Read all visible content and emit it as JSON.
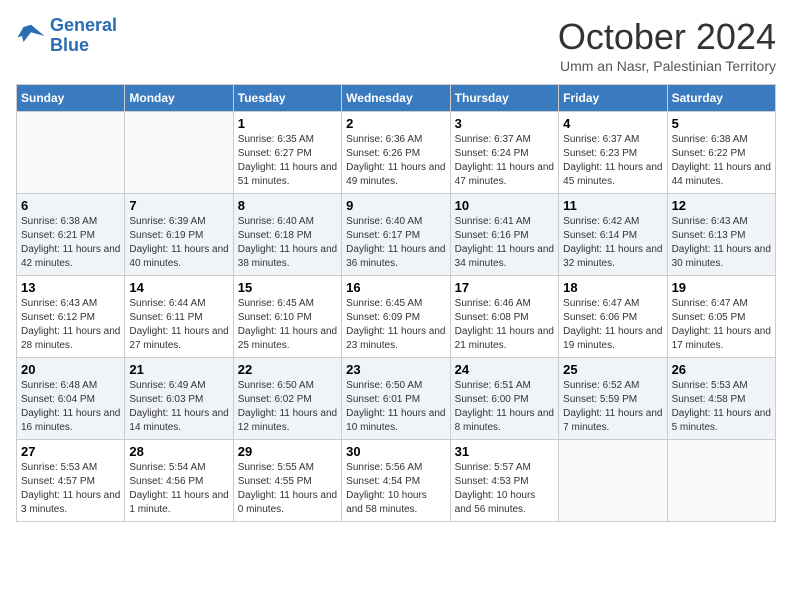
{
  "header": {
    "logo_line1": "General",
    "logo_line2": "Blue",
    "month_year": "October 2024",
    "location": "Umm an Nasr, Palestinian Territory"
  },
  "days_of_week": [
    "Sunday",
    "Monday",
    "Tuesday",
    "Wednesday",
    "Thursday",
    "Friday",
    "Saturday"
  ],
  "weeks": [
    [
      {
        "day": "",
        "info": ""
      },
      {
        "day": "",
        "info": ""
      },
      {
        "day": "1",
        "info": "Sunrise: 6:35 AM\nSunset: 6:27 PM\nDaylight: 11 hours and 51 minutes."
      },
      {
        "day": "2",
        "info": "Sunrise: 6:36 AM\nSunset: 6:26 PM\nDaylight: 11 hours and 49 minutes."
      },
      {
        "day": "3",
        "info": "Sunrise: 6:37 AM\nSunset: 6:24 PM\nDaylight: 11 hours and 47 minutes."
      },
      {
        "day": "4",
        "info": "Sunrise: 6:37 AM\nSunset: 6:23 PM\nDaylight: 11 hours and 45 minutes."
      },
      {
        "day": "5",
        "info": "Sunrise: 6:38 AM\nSunset: 6:22 PM\nDaylight: 11 hours and 44 minutes."
      }
    ],
    [
      {
        "day": "6",
        "info": "Sunrise: 6:38 AM\nSunset: 6:21 PM\nDaylight: 11 hours and 42 minutes."
      },
      {
        "day": "7",
        "info": "Sunrise: 6:39 AM\nSunset: 6:19 PM\nDaylight: 11 hours and 40 minutes."
      },
      {
        "day": "8",
        "info": "Sunrise: 6:40 AM\nSunset: 6:18 PM\nDaylight: 11 hours and 38 minutes."
      },
      {
        "day": "9",
        "info": "Sunrise: 6:40 AM\nSunset: 6:17 PM\nDaylight: 11 hours and 36 minutes."
      },
      {
        "day": "10",
        "info": "Sunrise: 6:41 AM\nSunset: 6:16 PM\nDaylight: 11 hours and 34 minutes."
      },
      {
        "day": "11",
        "info": "Sunrise: 6:42 AM\nSunset: 6:14 PM\nDaylight: 11 hours and 32 minutes."
      },
      {
        "day": "12",
        "info": "Sunrise: 6:43 AM\nSunset: 6:13 PM\nDaylight: 11 hours and 30 minutes."
      }
    ],
    [
      {
        "day": "13",
        "info": "Sunrise: 6:43 AM\nSunset: 6:12 PM\nDaylight: 11 hours and 28 minutes."
      },
      {
        "day": "14",
        "info": "Sunrise: 6:44 AM\nSunset: 6:11 PM\nDaylight: 11 hours and 27 minutes."
      },
      {
        "day": "15",
        "info": "Sunrise: 6:45 AM\nSunset: 6:10 PM\nDaylight: 11 hours and 25 minutes."
      },
      {
        "day": "16",
        "info": "Sunrise: 6:45 AM\nSunset: 6:09 PM\nDaylight: 11 hours and 23 minutes."
      },
      {
        "day": "17",
        "info": "Sunrise: 6:46 AM\nSunset: 6:08 PM\nDaylight: 11 hours and 21 minutes."
      },
      {
        "day": "18",
        "info": "Sunrise: 6:47 AM\nSunset: 6:06 PM\nDaylight: 11 hours and 19 minutes."
      },
      {
        "day": "19",
        "info": "Sunrise: 6:47 AM\nSunset: 6:05 PM\nDaylight: 11 hours and 17 minutes."
      }
    ],
    [
      {
        "day": "20",
        "info": "Sunrise: 6:48 AM\nSunset: 6:04 PM\nDaylight: 11 hours and 16 minutes."
      },
      {
        "day": "21",
        "info": "Sunrise: 6:49 AM\nSunset: 6:03 PM\nDaylight: 11 hours and 14 minutes."
      },
      {
        "day": "22",
        "info": "Sunrise: 6:50 AM\nSunset: 6:02 PM\nDaylight: 11 hours and 12 minutes."
      },
      {
        "day": "23",
        "info": "Sunrise: 6:50 AM\nSunset: 6:01 PM\nDaylight: 11 hours and 10 minutes."
      },
      {
        "day": "24",
        "info": "Sunrise: 6:51 AM\nSunset: 6:00 PM\nDaylight: 11 hours and 8 minutes."
      },
      {
        "day": "25",
        "info": "Sunrise: 6:52 AM\nSunset: 5:59 PM\nDaylight: 11 hours and 7 minutes."
      },
      {
        "day": "26",
        "info": "Sunrise: 5:53 AM\nSunset: 4:58 PM\nDaylight: 11 hours and 5 minutes."
      }
    ],
    [
      {
        "day": "27",
        "info": "Sunrise: 5:53 AM\nSunset: 4:57 PM\nDaylight: 11 hours and 3 minutes."
      },
      {
        "day": "28",
        "info": "Sunrise: 5:54 AM\nSunset: 4:56 PM\nDaylight: 11 hours and 1 minute."
      },
      {
        "day": "29",
        "info": "Sunrise: 5:55 AM\nSunset: 4:55 PM\nDaylight: 11 hours and 0 minutes."
      },
      {
        "day": "30",
        "info": "Sunrise: 5:56 AM\nSunset: 4:54 PM\nDaylight: 10 hours and 58 minutes."
      },
      {
        "day": "31",
        "info": "Sunrise: 5:57 AM\nSunset: 4:53 PM\nDaylight: 10 hours and 56 minutes."
      },
      {
        "day": "",
        "info": ""
      },
      {
        "day": "",
        "info": ""
      }
    ]
  ]
}
